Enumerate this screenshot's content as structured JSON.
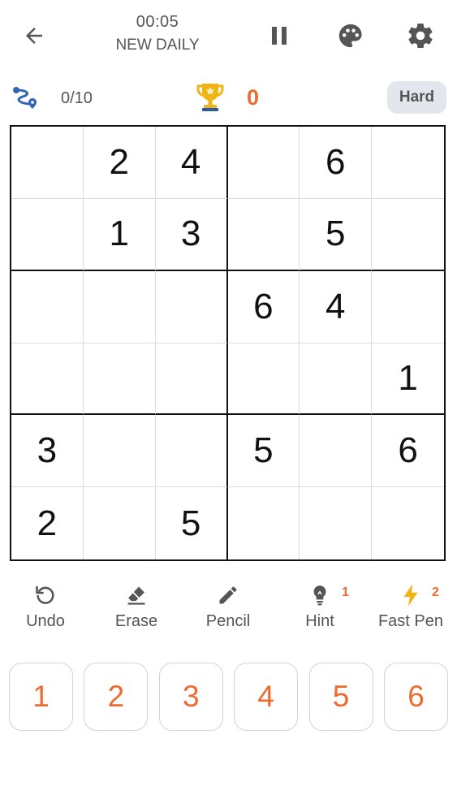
{
  "header": {
    "timer": "00:05",
    "mode": "NEW DAILY",
    "icons": {
      "back": "arrow-left-icon",
      "pause": "pause-icon",
      "theme": "palette-icon",
      "settings": "gear-icon"
    }
  },
  "status": {
    "progress": "0/10",
    "score": "0",
    "difficulty": "Hard"
  },
  "colors": {
    "accent": "#ee6a2f",
    "trophy": "#f1b415",
    "progress_icon": "#3166b3",
    "text_muted": "#555555",
    "badge_bg": "#e3e6ec"
  },
  "board": {
    "size": 6,
    "box_rows": 2,
    "box_cols": 3,
    "cells": [
      [
        "",
        "2",
        "4",
        "",
        "6",
        ""
      ],
      [
        "",
        "1",
        "3",
        "",
        "5",
        ""
      ],
      [
        "",
        "",
        "",
        "6",
        "4",
        ""
      ],
      [
        "",
        "",
        "",
        "",
        "",
        "1"
      ],
      [
        "3",
        "",
        "",
        "5",
        "",
        "6"
      ],
      [
        "2",
        "",
        "5",
        "",
        "",
        ""
      ]
    ]
  },
  "tools": {
    "undo": {
      "label": "Undo",
      "icon": "undo-icon"
    },
    "erase": {
      "label": "Erase",
      "icon": "eraser-icon"
    },
    "pencil": {
      "label": "Pencil",
      "icon": "pencil-icon"
    },
    "hint": {
      "label": "Hint",
      "icon": "lightbulb-icon",
      "badge": "1"
    },
    "fast_pen": {
      "label": "Fast Pen",
      "icon": "lightning-icon",
      "badge": "2"
    }
  },
  "numpad": [
    "1",
    "2",
    "3",
    "4",
    "5",
    "6"
  ]
}
